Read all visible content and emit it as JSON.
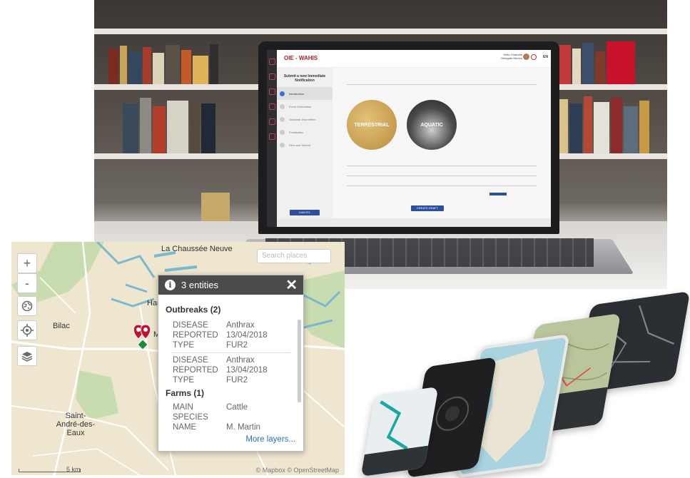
{
  "laptop_screen": {
    "app_title": "OIE - WAHIS",
    "user_name": "Hélio Charlotte",
    "user_role": "Delegate Mexico",
    "lang": "EN",
    "steps_heading": "Submit a new Immediate Notification",
    "steps": [
      "Introduction",
      "Event Information",
      "Outbreak Information",
      "Finalisation",
      "Files and Submit"
    ],
    "tile_terrestrial": "TERRESTRIAL",
    "tile_aquatic": "AQUATIC",
    "cancel_label": "CANCEL",
    "create_label": "CREATE DRAFT"
  },
  "map": {
    "search_placeholder": "Search places",
    "zoom_in": "+",
    "zoom_out": "-",
    "places": [
      "La Chaussée Neuve",
      "Bilac",
      "Hau",
      "M",
      "Saint-André-des-Eaux"
    ],
    "scale_label": "5 km",
    "attribution": "© Mapbox © OpenStreetMap",
    "popup": {
      "title": "3 entities",
      "outbreaks_heading": "Outbreaks (2)",
      "outbreaks": [
        {
          "disease_k": "DISEASE",
          "disease_v": "Anthrax",
          "reported_k": "REPORTED",
          "reported_v": "13/04/2018",
          "type_k": "TYPE",
          "type_v": "FUR2"
        },
        {
          "disease_k": "DISEASE",
          "disease_v": "Anthrax",
          "reported_k": "REPORTED",
          "reported_v": "13/04/2018",
          "type_k": "TYPE",
          "type_v": "FUR2"
        }
      ],
      "farms_heading": "Farms (1)",
      "farm": {
        "species_k": "MAIN SPECIES",
        "species_v": "Cattle",
        "name_k": "NAME",
        "name_v": "M. Martin"
      },
      "more_link": "More layers..."
    }
  },
  "colors": {
    "brand_red": "#a0232e",
    "button_blue": "#2d4f9e",
    "map_land": "#efe6cf",
    "map_water": "#a9d3df",
    "map_green": "#c8dcb0",
    "marker_red": "#c8102e",
    "marker_green": "#1e8a3a"
  }
}
